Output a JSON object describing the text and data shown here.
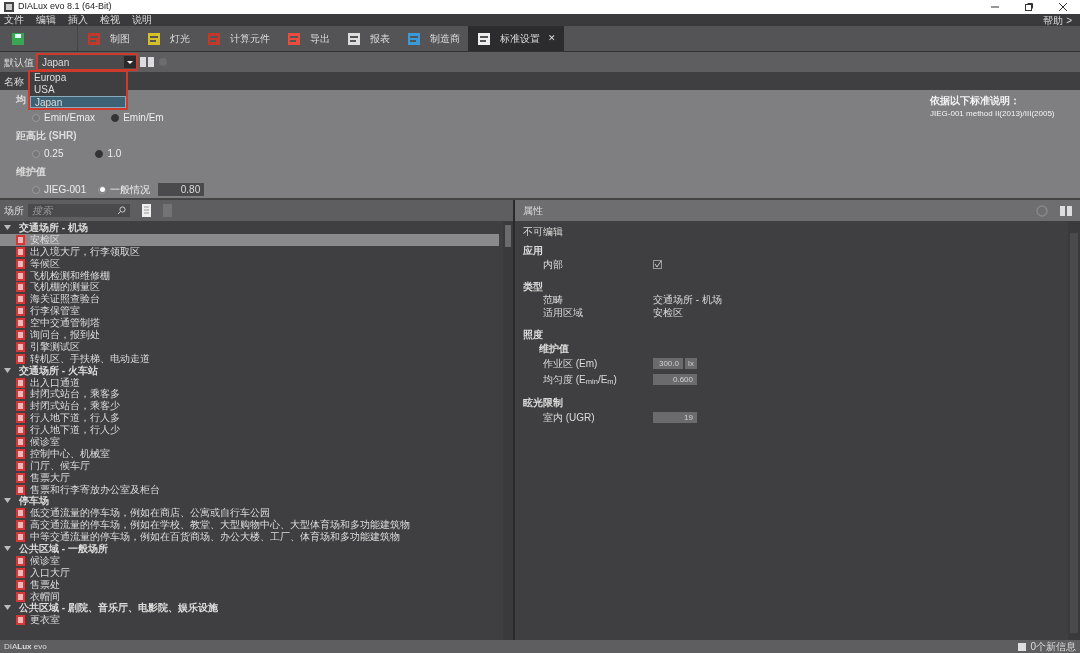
{
  "window": {
    "title": "DIALux evo 8.1  (64-Bit)"
  },
  "menu": [
    "文件",
    "编辑",
    "插入",
    "检视",
    "说明"
  ],
  "help_link": "帮助 >",
  "toolbar": [
    {
      "label": "制图",
      "selected": false
    },
    {
      "label": "灯光",
      "selected": false
    },
    {
      "label": "计算元件",
      "selected": false
    },
    {
      "label": "导出",
      "selected": false
    },
    {
      "label": "报表",
      "selected": false
    },
    {
      "label": "制造商",
      "selected": false
    },
    {
      "label": "标准设置",
      "selected": true
    }
  ],
  "close_glyph": "✕",
  "defaults": {
    "label": "默认值",
    "value": "Japan",
    "expanded": true,
    "options": [
      {
        "label": "Europa",
        "selected": false
      },
      {
        "label": "USA",
        "selected": false
      },
      {
        "label": "Japan",
        "selected": true
      }
    ]
  },
  "settings_header": "名称",
  "uniformity": {
    "label": "均",
    "options": [
      {
        "label": "Emin/Emax",
        "selected": false
      },
      {
        "label": "Emin/Em",
        "selected": true
      }
    ]
  },
  "ratio": {
    "label": "距高比 (SHR)",
    "options": [
      {
        "label": "0.25",
        "selected": false
      },
      {
        "label": "1.0",
        "selected": true
      }
    ]
  },
  "maintenance": {
    "label": "维护值",
    "options": [
      {
        "label": "JIEG-001",
        "selected": false
      },
      {
        "label": "一般情况",
        "selected": true
      }
    ],
    "value": "0.80"
  },
  "note": {
    "title": "依据以下标准说明：",
    "body": "JIEG-001 method II(2013)/III(2005)"
  },
  "places": {
    "label": "场所",
    "search_placeholder": "搜索",
    "tree": [
      {
        "label": "交通场所 - 机场",
        "expanded": true,
        "children": [
          {
            "label": "安检区",
            "selected": true
          },
          {
            "label": "出入境大厅，行李领取区",
            "selected": false
          },
          {
            "label": "等候区",
            "selected": false
          },
          {
            "label": "飞机检测和维修棚",
            "selected": false
          },
          {
            "label": "飞机棚的测量区",
            "selected": false
          },
          {
            "label": "海关证照查验台",
            "selected": false
          },
          {
            "label": "行李保管室",
            "selected": false
          },
          {
            "label": "空中交通管制塔",
            "selected": false
          },
          {
            "label": "询问台，报到处",
            "selected": false
          },
          {
            "label": "引擎测试区",
            "selected": false
          },
          {
            "label": "转机区、手扶梯、电动走道",
            "selected": false
          }
        ]
      },
      {
        "label": "交通场所 - 火车站",
        "expanded": true,
        "children": [
          {
            "label": "出入口通道",
            "selected": false
          },
          {
            "label": "封闭式站台，乘客多",
            "selected": false
          },
          {
            "label": "封闭式站台，乘客少",
            "selected": false
          },
          {
            "label": "行人地下道，行人多",
            "selected": false
          },
          {
            "label": "行人地下道，行人少",
            "selected": false
          },
          {
            "label": "候诊室",
            "selected": false
          },
          {
            "label": "控制中心、机械室",
            "selected": false
          },
          {
            "label": "门厅、候车厅",
            "selected": false
          },
          {
            "label": "售票大厅",
            "selected": false
          },
          {
            "label": "售票和行李寄放办公室及柜台",
            "selected": false
          }
        ]
      },
      {
        "label": "停车场",
        "expanded": true,
        "children": [
          {
            "label": "低交通流量的停车场，例如在商店、公寓或自行车公园",
            "selected": false
          },
          {
            "label": "高交通流量的停车场，例如在学校、教堂、大型购物中心、大型体育场和多功能建筑物",
            "selected": false
          },
          {
            "label": "中等交通流量的停车场，例如在百货商场、办公大楼、工厂、体育场和多功能建筑物",
            "selected": false
          }
        ]
      },
      {
        "label": "公共区域 - 一般场所",
        "expanded": true,
        "children": [
          {
            "label": "候诊室",
            "selected": false
          },
          {
            "label": "入口大厅",
            "selected": false
          },
          {
            "label": "售票处",
            "selected": false
          },
          {
            "label": "衣帽间",
            "selected": false
          }
        ]
      },
      {
        "label": "公共区域 - 剧院、音乐厅、电影院、娱乐设施",
        "expanded": true,
        "children": [
          {
            "label": "更衣室",
            "selected": false
          }
        ]
      }
    ]
  },
  "properties": {
    "title": "属性",
    "note": "不可编辑",
    "sections": [
      {
        "title": "应用",
        "rows": [
          {
            "kind": "check",
            "label": "内部",
            "checked": true
          }
        ]
      },
      {
        "title": "类型",
        "rows": [
          {
            "kind": "text",
            "label": "范畴",
            "value": "交通场所 - 机场"
          },
          {
            "kind": "text",
            "label": "适用区域",
            "value": "安检区"
          }
        ]
      },
      {
        "title": "照度",
        "rows": [
          {
            "kind": "subheading",
            "label": "维护值"
          },
          {
            "kind": "field",
            "label": "作业区 (Em)",
            "value": "300.0",
            "unit": "lx"
          },
          {
            "kind": "field",
            "label": "均匀度 (E$_{min}$/E$_{m}$)",
            "value": "0.600"
          }
        ]
      },
      {
        "title": "眩光限制",
        "rows": [
          {
            "kind": "field",
            "label": "室内 (UGR)",
            "value": "19"
          }
        ]
      }
    ]
  },
  "status": {
    "left": "DIA**Lux** evo",
    "right": "0个新信息"
  }
}
